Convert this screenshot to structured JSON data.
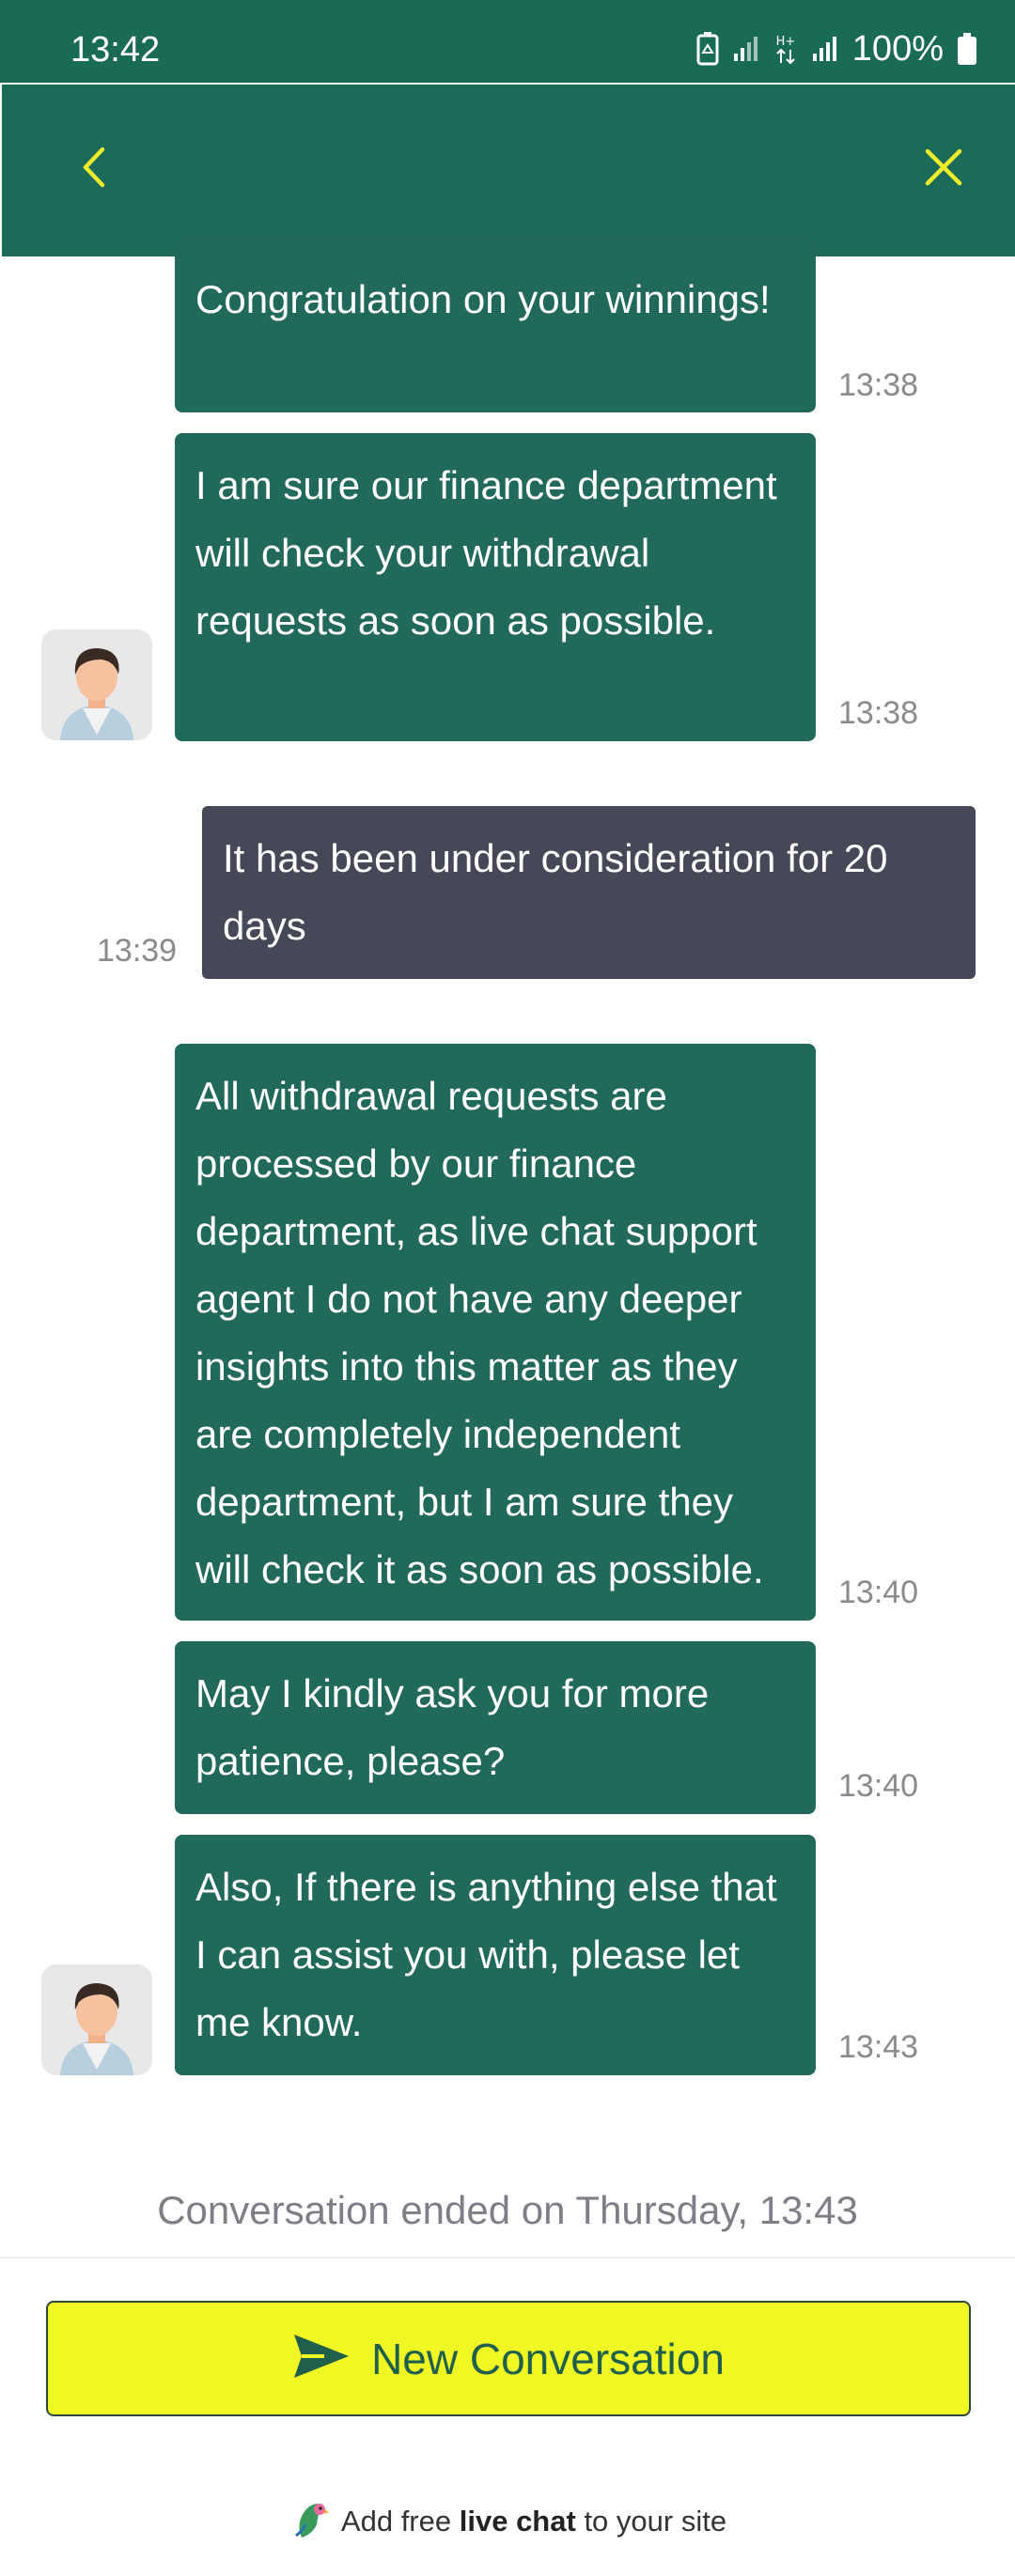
{
  "status_bar": {
    "time": "13:42",
    "battery": "100%",
    "network_type": "H+"
  },
  "header": {
    "back_icon": "chevron-left-icon",
    "close_icon": "close-icon",
    "accent_color": "#ecec2a"
  },
  "messages": [
    {
      "sender": "agent",
      "text": "Congratulation on your winnings!",
      "time": "13:38"
    },
    {
      "sender": "agent",
      "text": "I am sure our finance department will check your withdrawal requests as soon as possible.",
      "time": "13:38"
    },
    {
      "sender": "user",
      "text": "It has been under consideration for 20 days",
      "time": "13:39"
    },
    {
      "sender": "agent",
      "text": "All withdrawal requests are processed by our finance department, as live chat support agent I do not have any deeper insights into this matter as they are completely independent department, but I am sure they will check it as soon as possible.",
      "time": "13:40"
    },
    {
      "sender": "agent",
      "text": "May I kindly ask you for more patience, please?",
      "time": "13:40"
    },
    {
      "sender": "agent",
      "text": "Also, If there is anything else that I can assist you with, please let me know.",
      "time": "13:43"
    }
  ],
  "conversation_ended": "Conversation ended on Thursday, 13:43",
  "new_conversation_button": {
    "label": "New Conversation",
    "icon": "send-icon",
    "background": "#eff823"
  },
  "footer": {
    "prefix": "Add free",
    "bold": "live chat",
    "suffix": "to your site",
    "icon": "parrot-logo-icon"
  },
  "colors": {
    "brand_green": "#1c6b58",
    "agent_bubble": "#216a5b",
    "user_bubble": "#464857"
  }
}
